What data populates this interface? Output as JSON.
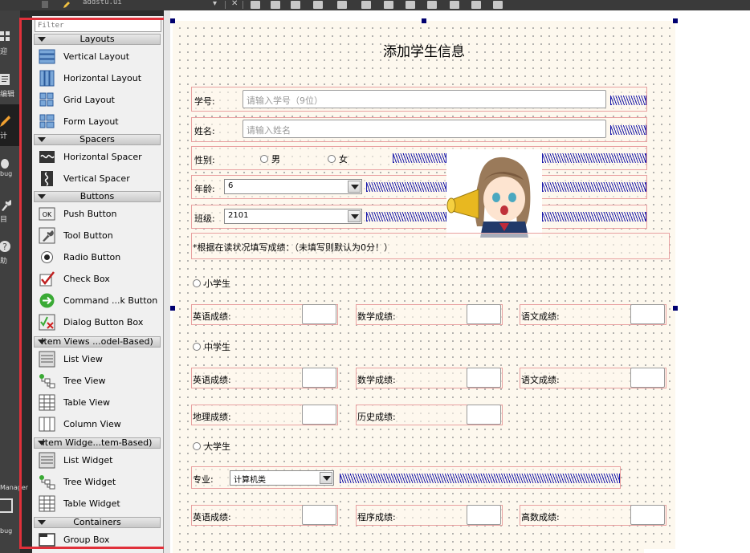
{
  "window": {
    "file_tab": "addstu.ui"
  },
  "modes": [
    {
      "id": "welcome",
      "label": "迎"
    },
    {
      "id": "edit",
      "label": "编辑"
    },
    {
      "id": "design",
      "label": "计"
    },
    {
      "id": "debug",
      "label": "bug"
    },
    {
      "id": "projects",
      "label": "目"
    },
    {
      "id": "help",
      "label": "助"
    }
  ],
  "sidebar_bottom": {
    "manager_label": "Manager",
    "debug_label": "bug"
  },
  "widget_box": {
    "filter_placeholder": "Filter",
    "categories": [
      {
        "label": "Layouts"
      },
      {
        "label": "Spacers"
      },
      {
        "label": "Buttons"
      },
      {
        "label": "Item Views ...odel-Based)"
      },
      {
        "label": "Item Widge...tem-Based)"
      },
      {
        "label": "Containers"
      }
    ],
    "items": [
      {
        "label": "Vertical Layout",
        "icon": "vertical-layout-icon"
      },
      {
        "label": "Horizontal Layout",
        "icon": "horizontal-layout-icon"
      },
      {
        "label": "Grid Layout",
        "icon": "grid-layout-icon"
      },
      {
        "label": "Form Layout",
        "icon": "form-layout-icon"
      },
      {
        "label": "Horizontal Spacer",
        "icon": "horizontal-spacer-icon"
      },
      {
        "label": "Vertical Spacer",
        "icon": "vertical-spacer-icon"
      },
      {
        "label": "Push Button",
        "icon": "push-button-icon"
      },
      {
        "label": "Tool Button",
        "icon": "tool-button-icon"
      },
      {
        "label": "Radio Button",
        "icon": "radio-button-icon"
      },
      {
        "label": "Check Box",
        "icon": "check-box-icon"
      },
      {
        "label": "Command ...k Button",
        "icon": "command-link-icon"
      },
      {
        "label": "Dialog Button Box",
        "icon": "dialog-button-box-icon"
      },
      {
        "label": "List View",
        "icon": "list-view-icon"
      },
      {
        "label": "Tree View",
        "icon": "tree-view-icon"
      },
      {
        "label": "Table View",
        "icon": "table-view-icon"
      },
      {
        "label": "Column View",
        "icon": "column-view-icon"
      },
      {
        "label": "List Widget",
        "icon": "list-widget-icon"
      },
      {
        "label": "Tree Widget",
        "icon": "tree-widget-icon"
      },
      {
        "label": "Table Widget",
        "icon": "table-widget-icon"
      },
      {
        "label": "Group Box",
        "icon": "group-box-icon"
      }
    ],
    "push_button_icon_text": "OK"
  },
  "form": {
    "title": "添加学生信息",
    "student_id": {
      "label": "学号:",
      "placeholder": "请输入学号（9位）"
    },
    "name": {
      "label": "姓名:",
      "placeholder": "请输入姓名"
    },
    "gender": {
      "label": "性别:",
      "options": [
        "男",
        "女"
      ]
    },
    "age": {
      "label": "年龄:",
      "value": "6"
    },
    "class": {
      "label": "班级:",
      "value": "2101"
    },
    "note": "*根据在读状况填写成绩：（未填写则默认为0分！）",
    "primary": {
      "label": "小学生",
      "fields": [
        "英语成绩:",
        "数学成绩:",
        "语文成绩:"
      ]
    },
    "middle": {
      "label": "中学生",
      "fields_row1": [
        "英语成绩:",
        "数学成绩:",
        "语文成绩:"
      ],
      "fields_row2": [
        "地理成绩:",
        "历史成绩:"
      ]
    },
    "university": {
      "label": "大学生",
      "major_label": "专业:",
      "major_value": "计算机类",
      "fields": [
        "英语成绩:",
        "程序成绩:",
        "高数成绩:"
      ]
    }
  },
  "colors": {
    "highlight_box": "#e0303a",
    "form_bg": "#fdf8ee",
    "layout_border": "#e8a0a0",
    "handle": "#000070"
  }
}
